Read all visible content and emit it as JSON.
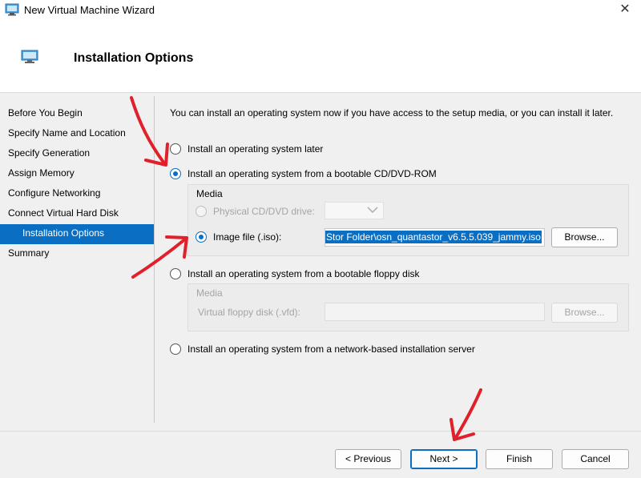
{
  "window": {
    "title": "New Virtual Machine Wizard",
    "close_glyph": "✕"
  },
  "header": {
    "title": "Installation Options"
  },
  "nav": {
    "items": [
      {
        "label": "Before You Begin"
      },
      {
        "label": "Specify Name and Location"
      },
      {
        "label": "Specify Generation"
      },
      {
        "label": "Assign Memory"
      },
      {
        "label": "Configure Networking"
      },
      {
        "label": "Connect Virtual Hard Disk"
      },
      {
        "label": "Installation Options",
        "active": true
      },
      {
        "label": "Summary"
      }
    ]
  },
  "main": {
    "intro": "You can install an operating system now if you have access to the setup media, or you can install it later.",
    "options": [
      {
        "label": "Install an operating system later",
        "checked": false
      },
      {
        "label": "Install an operating system from a bootable CD/DVD-ROM",
        "checked": true
      },
      {
        "label": "Install an operating system from a bootable floppy disk",
        "checked": false
      },
      {
        "label": "Install an operating system from a network-based installation server",
        "checked": false
      }
    ],
    "cd_media": {
      "group_title": "Media",
      "physical_label": "Physical CD/DVD drive:",
      "physical_value": "",
      "image_label": "Image file (.iso):",
      "image_value": "Stor Folder\\osn_quantastor_v6.5.5.039_jammy.iso",
      "browse_label": "Browse..."
    },
    "floppy_media": {
      "group_title": "Media",
      "vfd_label": "Virtual floppy disk (.vfd):",
      "vfd_value": "",
      "browse_label": "Browse..."
    }
  },
  "footer": {
    "previous_label": "< Previous",
    "next_label": "Next >",
    "finish_label": "Finish",
    "cancel_label": "Cancel"
  },
  "colors": {
    "accent": "#0a6fc2",
    "annotation": "#e0202a"
  },
  "icons": {
    "window": "monitor-icon",
    "header": "monitor-icon",
    "dropdown": "chevron-down-icon",
    "annotation": "red-arrow"
  }
}
